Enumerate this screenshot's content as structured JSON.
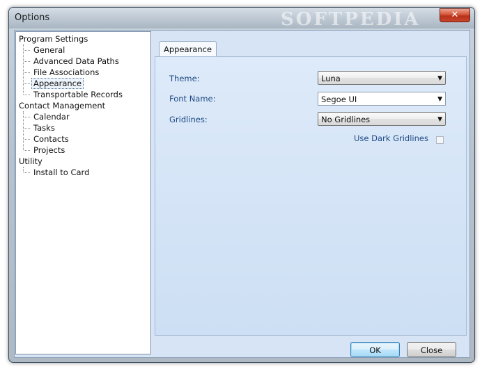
{
  "window": {
    "title": "Options",
    "watermark": "SOFTPEDIA",
    "close_glyph": "✕"
  },
  "tree": {
    "groups": [
      {
        "label": "Program Settings",
        "children": [
          "General",
          "Advanced Data Paths",
          "File Associations",
          "Appearance",
          "Transportable Records"
        ]
      },
      {
        "label": "Contact Management",
        "children": [
          "Calendar",
          "Tasks",
          "Contacts",
          "Projects"
        ]
      },
      {
        "label": "Utility",
        "children": [
          "Install to Card"
        ]
      }
    ],
    "selected": "Appearance"
  },
  "tab": {
    "label": "Appearance"
  },
  "form": {
    "theme_label": "Theme:",
    "theme_value": "Luna",
    "font_label": "Font Name:",
    "font_value": "Segoe UI",
    "gridlines_label": "Gridlines:",
    "gridlines_value": "No Gridlines",
    "dark_gridlines_label": "Use Dark Gridlines",
    "dark_gridlines_checked": false,
    "dropdown_arrow": "▼"
  },
  "buttons": {
    "ok": "OK",
    "close": "Close"
  },
  "colors": {
    "panel": "#d6e4f5",
    "label": "#1f4a86",
    "accent": "#3c7fb1"
  }
}
